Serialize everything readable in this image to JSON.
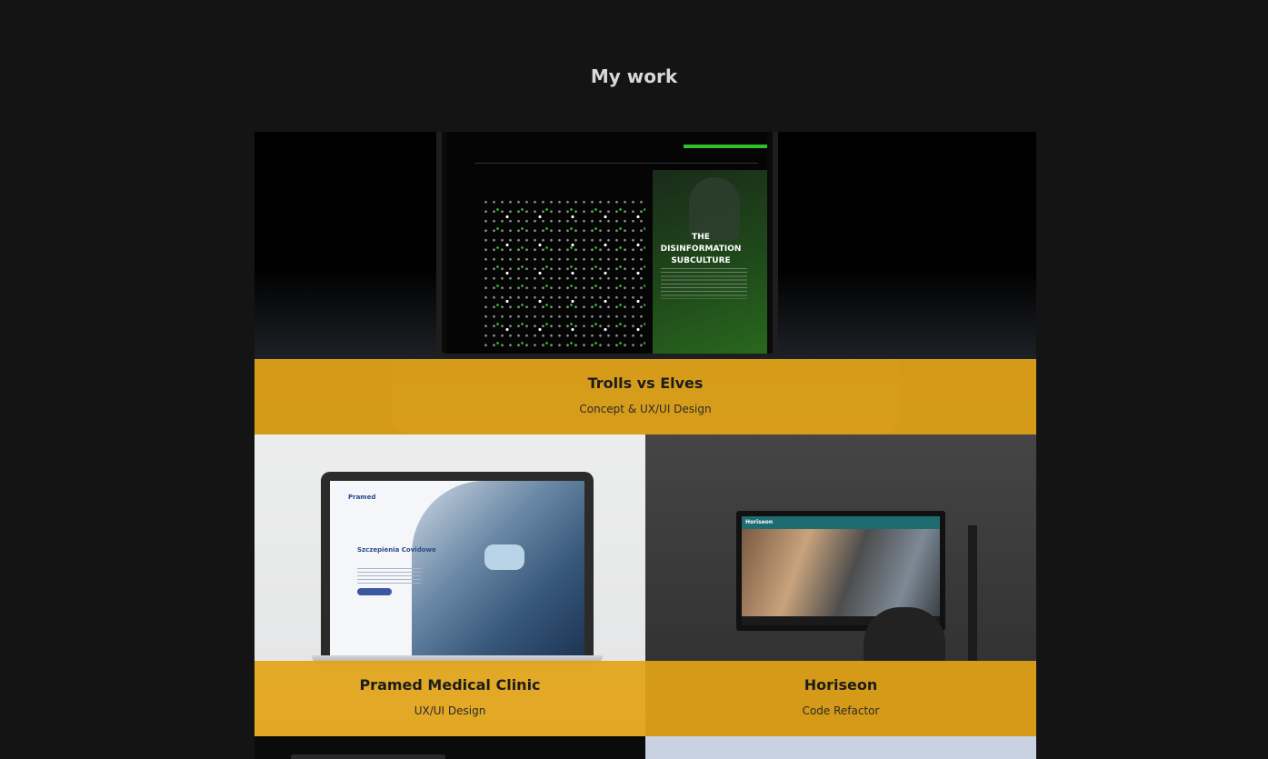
{
  "section": {
    "title": "My work"
  },
  "projects": [
    {
      "title": "Trolls vs Elves",
      "subtitle": "Concept & UX/UI Design"
    },
    {
      "title": "Pramed Medical Clinic",
      "subtitle": "UX/UI Design"
    },
    {
      "title": "Horiseon",
      "subtitle": "Code Refactor"
    }
  ],
  "screens": {
    "trolls": {
      "heading": "THE DISINFORMATION SUBCULTURE"
    },
    "pramed": {
      "logo": "Pramed",
      "heading": "Szczepienia Covidowe"
    },
    "horiseon": {
      "logo": "Horiseon"
    }
  },
  "colors": {
    "background": "#141414",
    "label_overlay": "#e2a417",
    "title_text": "#d9d9d9"
  }
}
